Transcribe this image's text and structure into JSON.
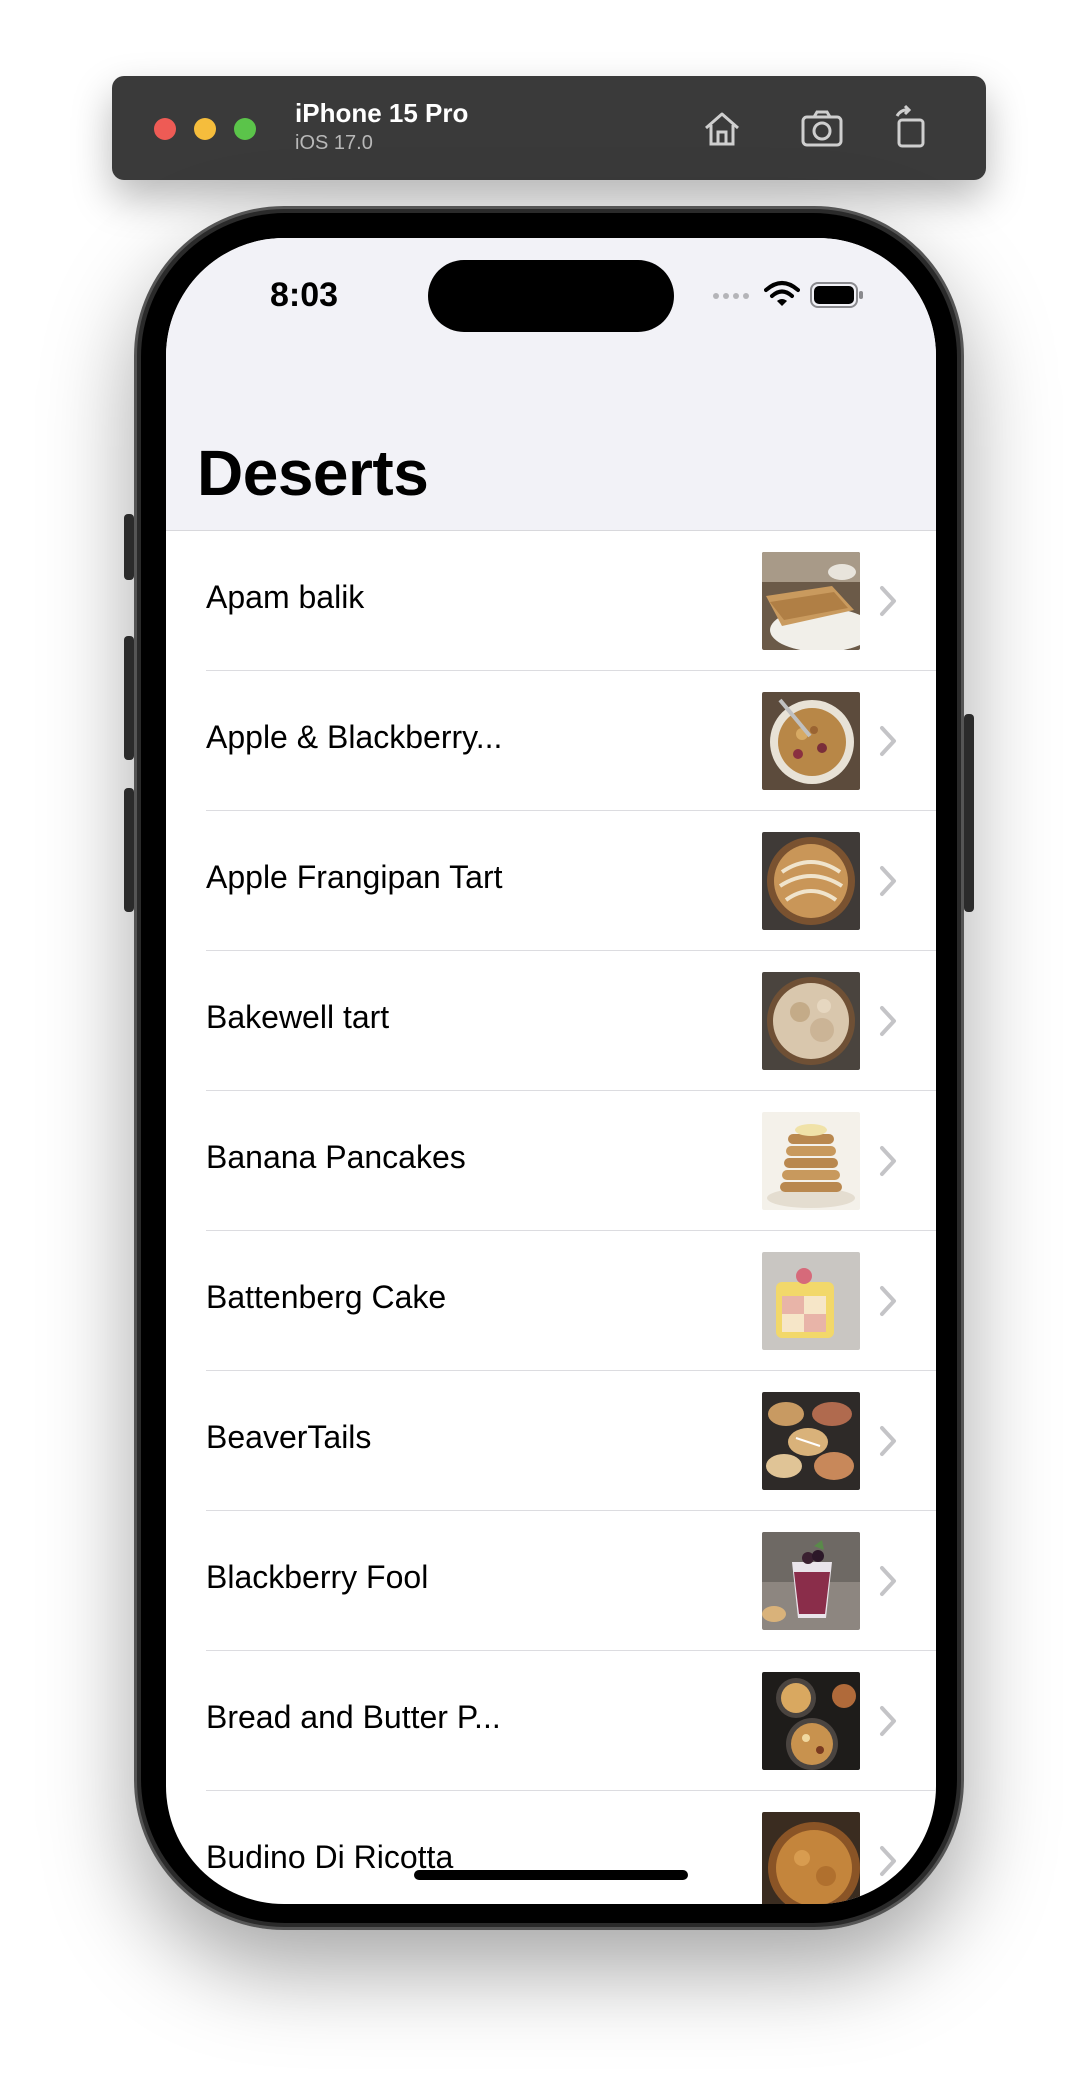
{
  "simulator": {
    "device_name": "iPhone 15 Pro",
    "os_version": "iOS 17.0",
    "toolbar_icons": [
      "home-icon",
      "screenshot-icon",
      "rotate-icon"
    ]
  },
  "status_bar": {
    "time": "8:03",
    "icons": [
      "signal-icon",
      "wifi-icon",
      "battery-icon"
    ]
  },
  "nav": {
    "title": "Deserts"
  },
  "list": {
    "items": [
      {
        "name": "Apam balik",
        "thumb": "pancake-plate"
      },
      {
        "name": "Apple & Blackberry...",
        "thumb": "crumble-bowl"
      },
      {
        "name": "Apple Frangipan Tart",
        "thumb": "tart-apple"
      },
      {
        "name": "Bakewell tart",
        "thumb": "tart-sugar"
      },
      {
        "name": "Banana Pancakes",
        "thumb": "pancake-stack"
      },
      {
        "name": "Battenberg Cake",
        "thumb": "battenberg"
      },
      {
        "name": "BeaverTails",
        "thumb": "pastries"
      },
      {
        "name": "Blackberry Fool",
        "thumb": "glass-dessert"
      },
      {
        "name": "Bread and Butter P...",
        "thumb": "baked-pans"
      },
      {
        "name": "Budino Di Ricotta",
        "thumb": "ricotta-cake"
      }
    ]
  },
  "colors": {
    "nav_background": "#f2f2f7",
    "separator": "#dcdce0",
    "chevron": "#c4c4c7",
    "toolbar": "#3a3a3a"
  }
}
